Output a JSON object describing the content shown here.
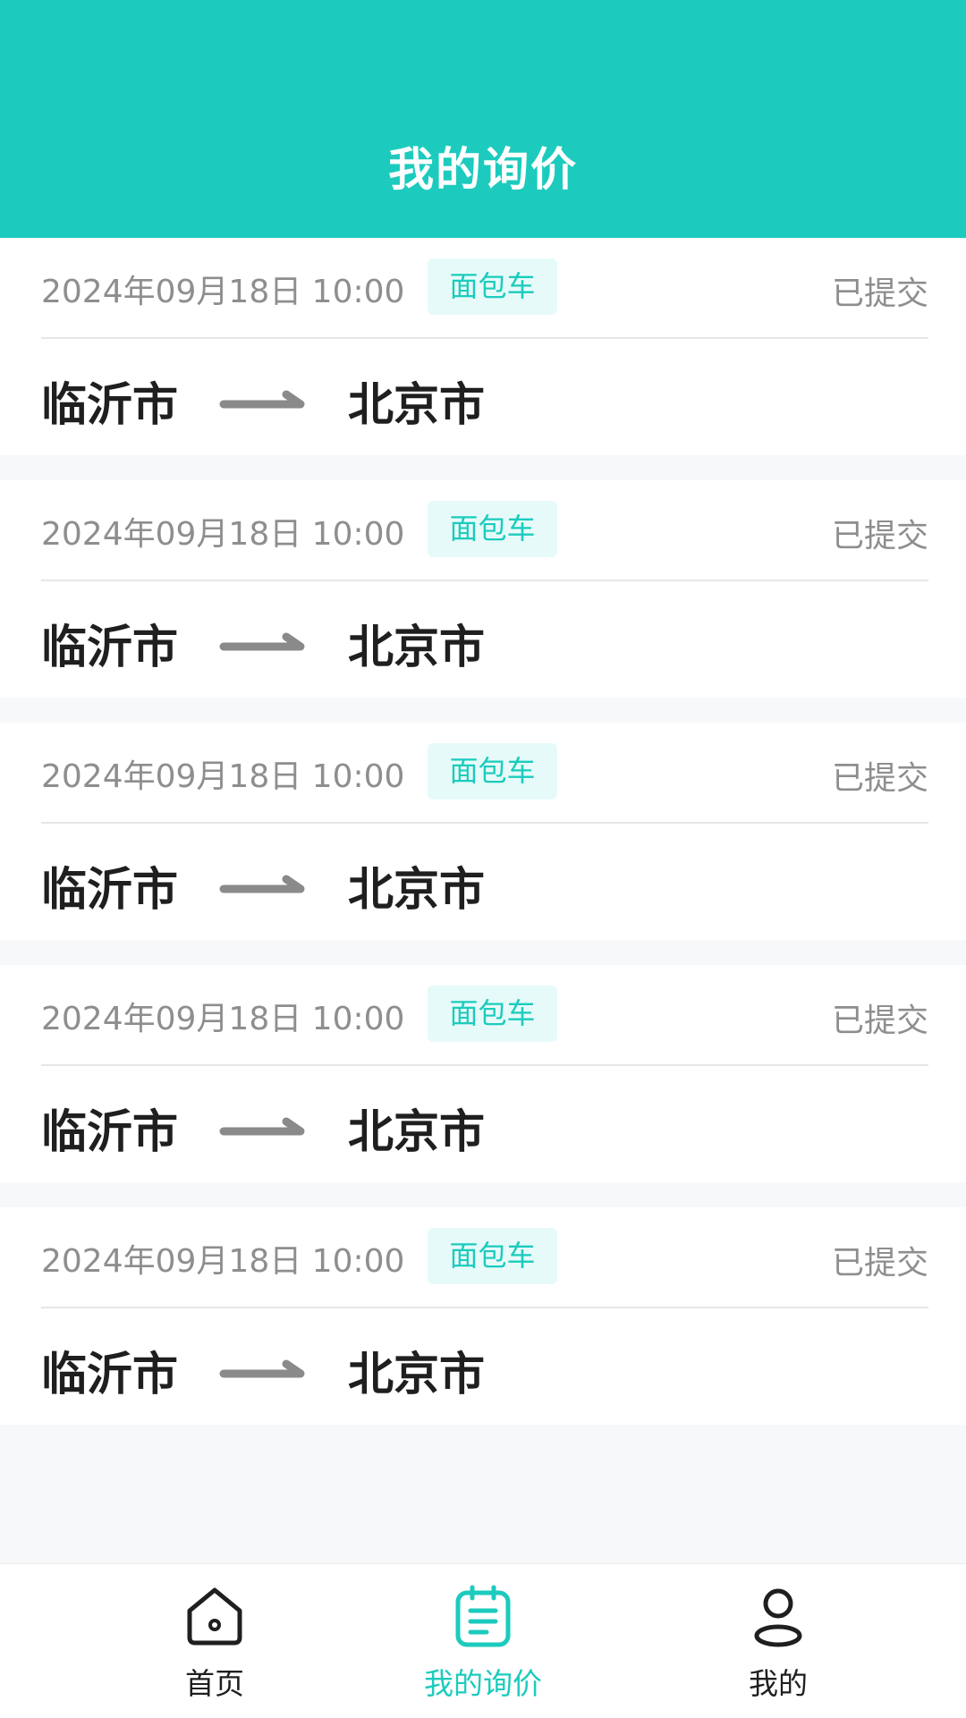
{
  "header": {
    "title": "我的询价"
  },
  "inquiries": [
    {
      "date": "2024年09月18日 10:00",
      "vehicle": "面包车",
      "status": "已提交",
      "from": "临沂市",
      "to": "北京市"
    },
    {
      "date": "2024年09月18日 10:00",
      "vehicle": "面包车",
      "status": "已提交",
      "from": "临沂市",
      "to": "北京市"
    },
    {
      "date": "2024年09月18日 10:00",
      "vehicle": "面包车",
      "status": "已提交",
      "from": "临沂市",
      "to": "北京市"
    },
    {
      "date": "2024年09月18日 10:00",
      "vehicle": "面包车",
      "status": "已提交",
      "from": "临沂市",
      "to": "北京市"
    },
    {
      "date": "2024年09月18日 10:00",
      "vehicle": "面包车",
      "status": "已提交",
      "from": "临沂市",
      "to": "北京市"
    }
  ],
  "tabbar": {
    "home": {
      "label": "首页",
      "icon": "home-icon"
    },
    "inquiry": {
      "label": "我的询价",
      "icon": "clipboard-list-icon",
      "active": true
    },
    "mine": {
      "label": "我的",
      "icon": "user-icon"
    }
  },
  "colors": {
    "accent": "#1ccbbd",
    "tag_background": "#e6fbf9",
    "secondary_text": "#8e8e8e",
    "primary_text": "#1f1f1f",
    "page_background": "#f7f8fa"
  }
}
